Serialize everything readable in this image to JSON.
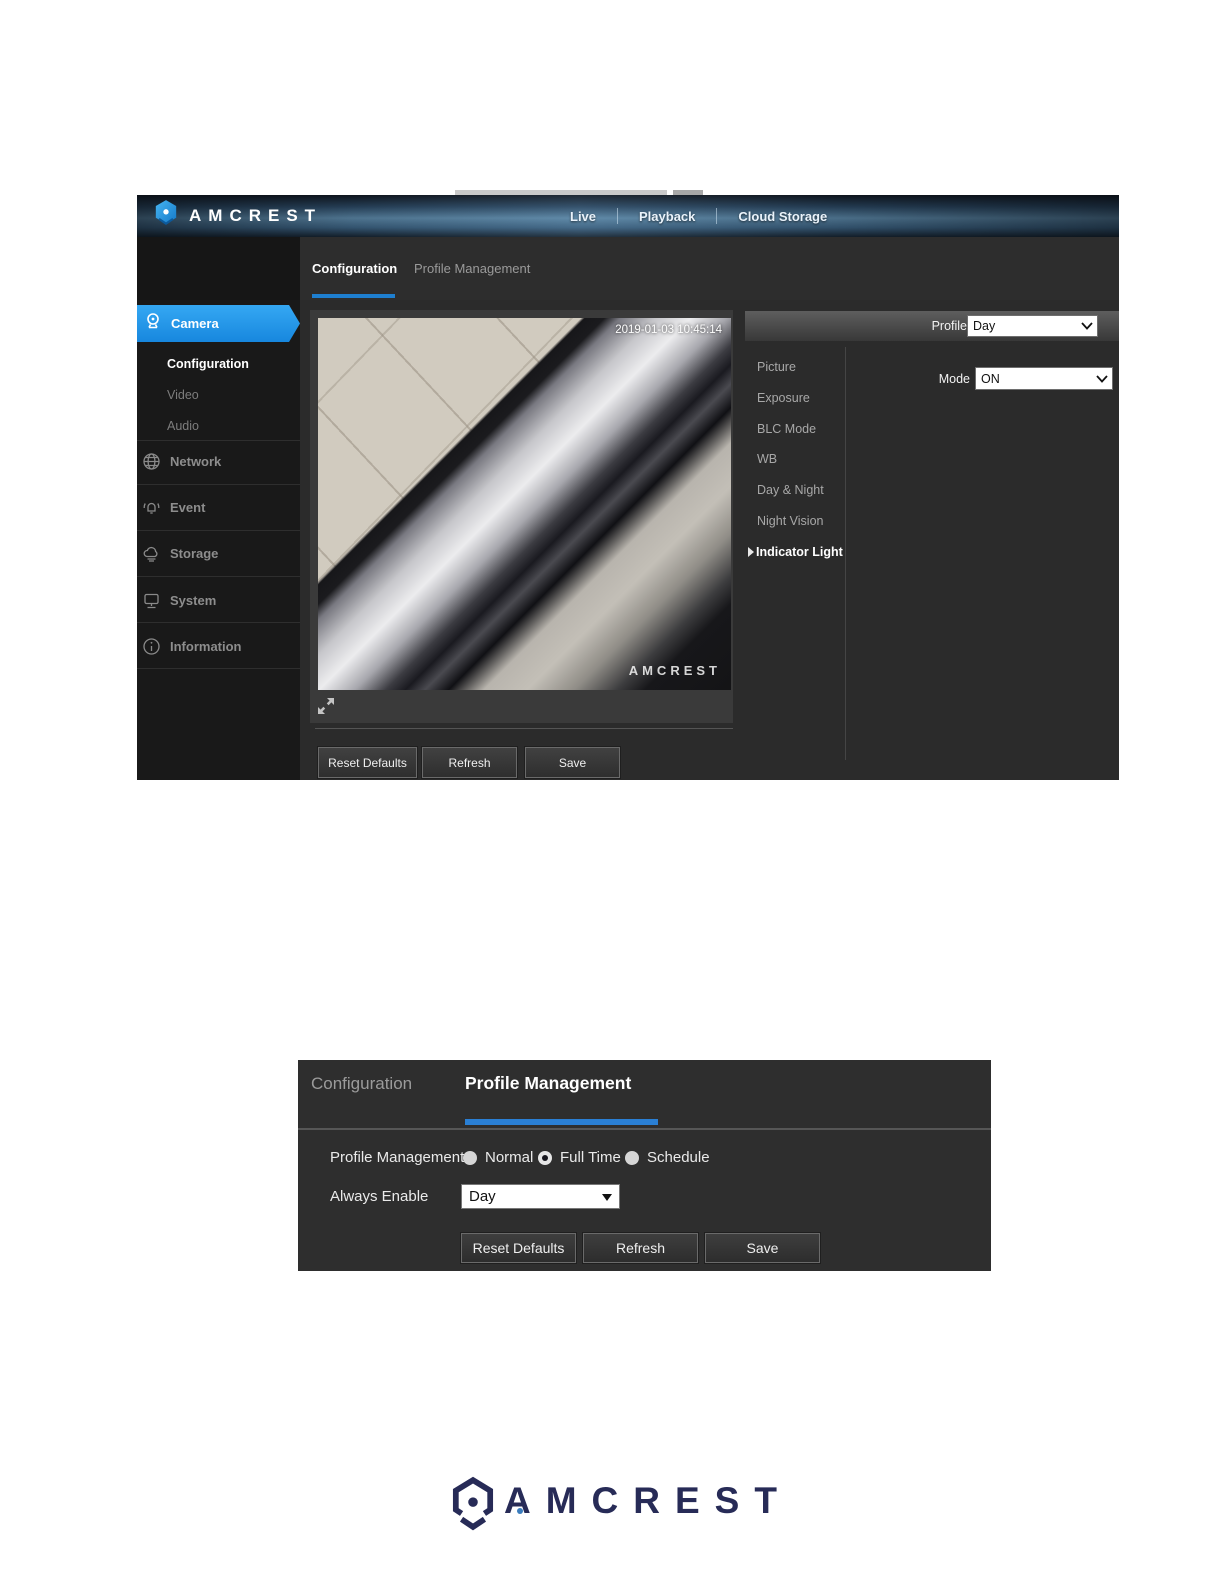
{
  "camera_ui": {
    "header": {
      "brand": "AMCREST",
      "nav": [
        "Live",
        "Playback",
        "Cloud Storage"
      ]
    },
    "tabs": {
      "configuration": "Configuration",
      "profile_management": "Profile Management"
    },
    "sidebar": {
      "camera": {
        "label": "Camera",
        "children": [
          "Configuration",
          "Video",
          "Audio"
        ],
        "active_child": "Configuration"
      },
      "items": [
        "Network",
        "Event",
        "Storage",
        "System",
        "Information"
      ]
    },
    "preview": {
      "timestamp": "2019-01-03 10:45:14",
      "watermark": "AMCREST"
    },
    "settings_menu": {
      "items": [
        "Picture",
        "Exposure",
        "BLC Mode",
        "WB",
        "Day & Night",
        "Night Vision"
      ],
      "active": "Indicator Light"
    },
    "fields": {
      "profile_label": "Profile",
      "profile_value": "Day",
      "mode_label": "Mode",
      "mode_value": "ON"
    },
    "buttons": {
      "reset": "Reset Defaults",
      "refresh": "Refresh",
      "save": "Save"
    }
  },
  "profile_panel": {
    "tabs": {
      "configuration": "Configuration",
      "profile_management": "Profile Management"
    },
    "radio_group": {
      "label": "Profile Management",
      "options": [
        "Normal",
        "Full Time",
        "Schedule"
      ],
      "selected": "Full Time"
    },
    "always_enable": {
      "label": "Always Enable",
      "value": "Day"
    },
    "buttons": {
      "reset": "Reset Defaults",
      "refresh": "Refresh",
      "save": "Save"
    }
  },
  "footer": {
    "brand": "AMCREST"
  },
  "icons": {
    "brand": "amcrest-hexagon-logo",
    "sidebar": [
      "camera-icon",
      "network-globe-icon",
      "event-bell-icon",
      "storage-cloud-icon",
      "system-monitor-icon",
      "information-icon"
    ],
    "preview": "expand-arrows-icon",
    "selects": "chevron-down-icon"
  },
  "colors": {
    "accent_blue": "#2196e8",
    "tab_underline": "#1e7fd0",
    "sidebar_active": "#1787de",
    "panel_dark": "#2b2b2b",
    "sidebar_dark": "#191919",
    "logo_navy": "#272b57",
    "logo_blue": "#2aa0e8"
  }
}
